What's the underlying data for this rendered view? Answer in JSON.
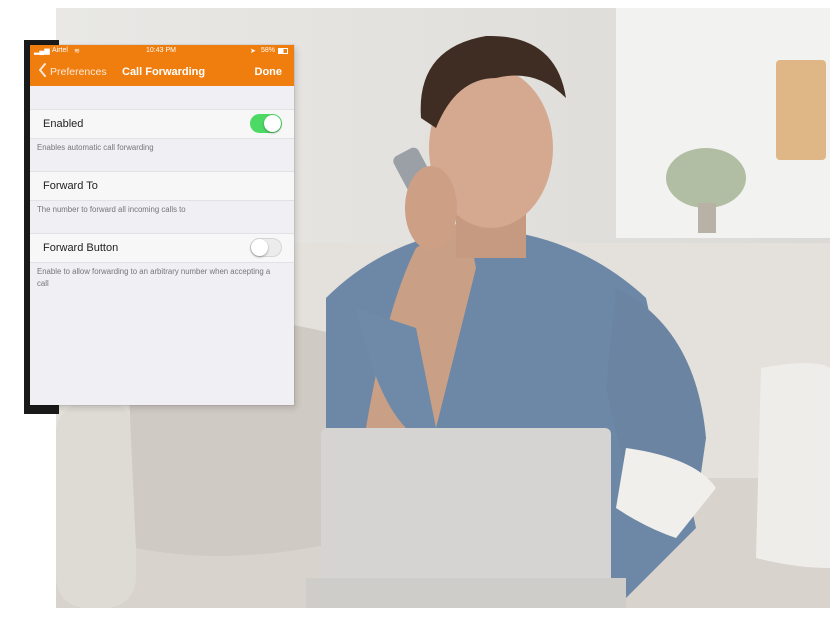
{
  "status_bar": {
    "carrier": "Airtel",
    "time": "10:43 PM",
    "battery": "58%"
  },
  "nav": {
    "back_label": "Preferences",
    "title": "Call Forwarding",
    "done_label": "Done"
  },
  "settings": [
    {
      "label": "Enabled",
      "description": "Enables automatic call forwarding",
      "toggle": true
    },
    {
      "label": "Forward To",
      "description": "The number to forward all incoming calls to"
    },
    {
      "label": "Forward Button",
      "description": "Enable to allow forwarding to an arbitrary number when accepting a call",
      "toggle": false
    }
  ],
  "colors": {
    "accent": "#f07e0f",
    "toggle_on": "#4cd964",
    "shirt": "#6d88a6"
  }
}
